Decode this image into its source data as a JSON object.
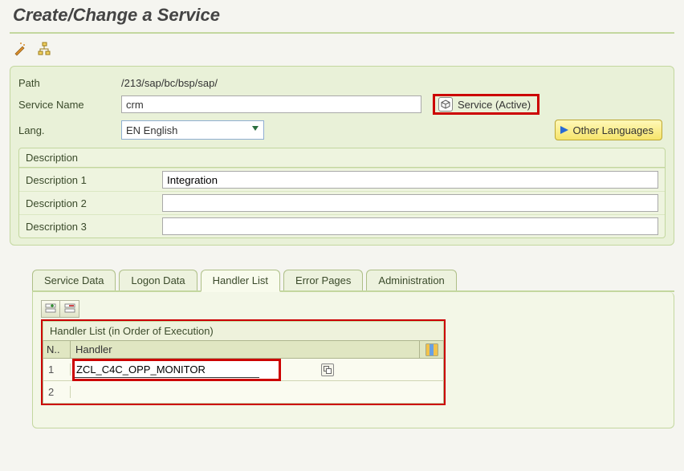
{
  "title": "Create/Change a Service",
  "toolbar": {
    "edit_icon": "edit-icon",
    "hierarchy_icon": "hierarchy-icon"
  },
  "form": {
    "path_label": "Path",
    "path_value": "/213/sap/bc/bsp/sap/",
    "service_name_label": "Service Name",
    "service_name_value": "crm",
    "status_text": "Service (Active)",
    "lang_label": "Lang.",
    "lang_value": "EN English",
    "other_lang_label": "Other Languages"
  },
  "description": {
    "group_title": "Description",
    "rows": [
      {
        "label": "Description 1",
        "value": "Integration"
      },
      {
        "label": "Description 2",
        "value": ""
      },
      {
        "label": "Description 3",
        "value": ""
      }
    ]
  },
  "tabs": {
    "items": [
      {
        "label": "Service Data",
        "active": false
      },
      {
        "label": "Logon Data",
        "active": false
      },
      {
        "label": "Handler List",
        "active": true
      },
      {
        "label": "Error Pages",
        "active": false
      },
      {
        "label": "Administration",
        "active": false
      }
    ]
  },
  "handler_grid": {
    "title": "Handler List (in Order of Execution)",
    "col_n": "N..",
    "col_handler": "Handler",
    "rows": [
      {
        "n": "1",
        "handler": "ZCL_C4C_OPP_MONITOR"
      },
      {
        "n": "2",
        "handler": ""
      }
    ]
  }
}
